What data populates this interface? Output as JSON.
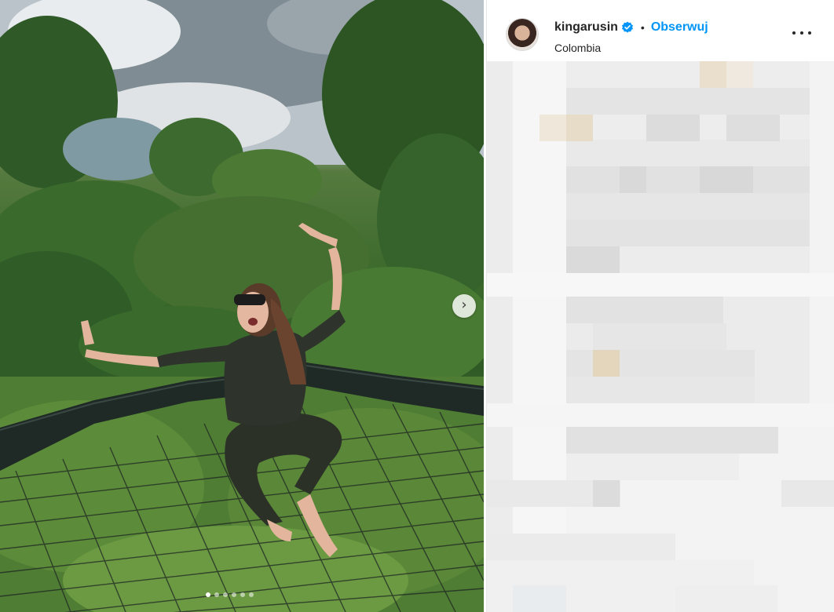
{
  "post": {
    "username": "kingarusin",
    "separator": "•",
    "follow_label": "Obserwuj",
    "location": "Colombia",
    "more_icon": "more-options-icon",
    "verified_icon": "verified-badge-icon"
  },
  "carousel": {
    "next_icon": "chevron-right-icon",
    "next_glyph": "›",
    "slide_count": 6,
    "active_index": 0
  },
  "colors": {
    "follow": "#0095f6",
    "text": "#262626",
    "verified": "#0095f6"
  }
}
